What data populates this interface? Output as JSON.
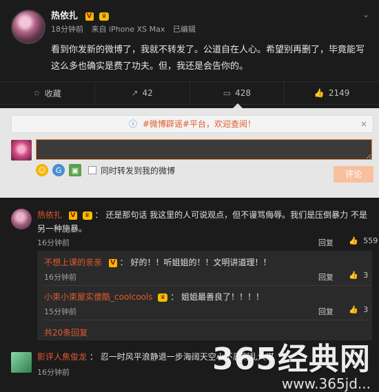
{
  "post": {
    "author": "热依扎",
    "meta": {
      "time": "18分钟前",
      "source": "来自 iPhone XS Max",
      "edited": "已编辑"
    },
    "content": "看到你发新的微博了，我就不转发了。公道自在人心。希望别再删了，毕竟能写这么多也确实是费了功夫。但，我还是会告你的。",
    "actions": {
      "favorite": "收藏",
      "repost": "42",
      "comment": "428",
      "like": "2149"
    }
  },
  "composer": {
    "banner": "#微博辟谣#平台，欢迎查阅！",
    "placeholder": "",
    "repost_checkbox_label": "同时转发到我的微博",
    "submit": "评论"
  },
  "comments": [
    {
      "author": "热依扎",
      "text": "还是那句话 我这里的人可说观点，但不谩骂侮辱。我们是压倒暴力 不是另一种施暴。",
      "time": "16分钟前",
      "reply": "回复",
      "likes": "559"
    }
  ],
  "subcomments": [
    {
      "author": "不想上课的亲亲",
      "text": "好的！！听姐姐的！！文明讲道理！！",
      "time": "16分钟前",
      "reply": "回复",
      "likes": "3"
    },
    {
      "author": "小束小束屋实傻酷_coolcools",
      "text": "姐姐最善良了！！！！",
      "time": "15分钟前",
      "reply": "回复",
      "likes": "3"
    }
  ],
  "subthread_more": "共20条回复",
  "comment2": {
    "author": "影评人焦俊龙",
    "text": "忍一时风平浪静退一步海阔天空小不忍则乱大谋",
    "time": "16分钟前"
  },
  "watermark": {
    "big": "365经典网",
    "small": "www.365jd..."
  },
  "icons": {
    "favorite": "star-icon",
    "repost": "share-icon",
    "comment": "comment-icon",
    "like": "thumb-up-icon",
    "banner_info": "info-icon",
    "close": "close-icon",
    "emoji": "emoji-icon",
    "gif": "gif-icon",
    "image": "image-icon",
    "vip": "vip-badge",
    "crown": "crown-badge",
    "dropdown": "chevron-down-icon"
  }
}
